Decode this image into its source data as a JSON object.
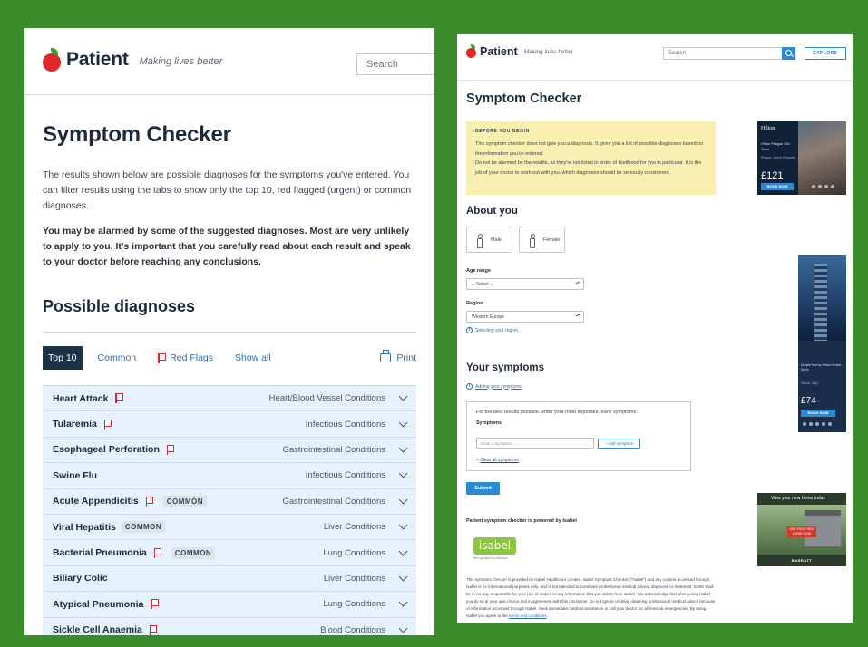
{
  "left": {
    "brand": "Patient",
    "tagline": "Making lives better",
    "search_placeholder": "Search",
    "title": "Symptom Checker",
    "intro": "The results shown below are possible diagnoses for the symptoms you've entered. You can filter results using the tabs to show only the top 10, red flagged (urgent) or common diagnoses.",
    "warning": "You may be alarmed by some of the suggested diagnoses. Most are very unlikely to apply to you. It's important that you carefully read about each result and speak to your doctor before reaching any conclusions.",
    "section_title": "Possible diagnoses",
    "tabs": [
      "Top 10",
      "Common",
      "Red Flags",
      "Show all"
    ],
    "print_label": "Print",
    "badge_common": "COMMON",
    "diagnoses": [
      {
        "name": "Heart Attack",
        "category": "Heart/Blood Vessel Conditions",
        "red_flag": true,
        "common": false
      },
      {
        "name": "Tularemia",
        "category": "Infectious Conditions",
        "red_flag": true,
        "common": false
      },
      {
        "name": "Esophageal Perforation",
        "category": "Gastrointestinal Conditions",
        "red_flag": true,
        "common": false
      },
      {
        "name": "Swine Flu",
        "category": "Infectious Conditions",
        "red_flag": false,
        "common": false
      },
      {
        "name": "Acute Appendicitis",
        "category": "Gastrointestinal Conditions",
        "red_flag": true,
        "common": true
      },
      {
        "name": "Viral Hepatitis",
        "category": "Liver Conditions",
        "red_flag": false,
        "common": true
      },
      {
        "name": "Bacterial Pneumonia",
        "category": "Lung Conditions",
        "red_flag": true,
        "common": true
      },
      {
        "name": "Biliary Colic",
        "category": "Liver Conditions",
        "red_flag": false,
        "common": false
      },
      {
        "name": "Atypical Pneumonia",
        "category": "Lung Conditions",
        "red_flag": true,
        "common": false
      },
      {
        "name": "Sickle Cell Anaemia",
        "category": "Blood Conditions",
        "red_flag": true,
        "common": false
      }
    ]
  },
  "right": {
    "brand": "Patient",
    "tagline": "Making lives better",
    "search_placeholder": "Search",
    "explore_label": "EXPLORE",
    "title": "Symptom Checker",
    "notice_title": "BEFORE YOU BEGIN",
    "notice_p1": "This symptom checker does not give you a diagnosis. It gives you a list of possible diagnoses based on the information you've entered.",
    "notice_p2": "Do not be alarmed by the results, as they're not listed in order of likelihood for you in particular. It is the job of your doctor to work out with you, which diagnoses should be seriously considered.",
    "about_title": "About you",
    "male_label": "Male",
    "female_label": "Female",
    "age_label": "Age range",
    "age_value": "-- Select --",
    "region_label": "Region",
    "region_value": "Western Europe",
    "region_help": "Selecting your region",
    "symptoms_title": "Your symptoms",
    "symptoms_help": "Adding your symptoms",
    "symptoms_intro": "For the best results possible, enter your most important, early symptoms.",
    "symptoms_label": "Symptoms",
    "symptom_placeholder": "Enter a symptom...",
    "add_symptom_label": "+ Add symptom",
    "clear_label": "Clear all symptoms",
    "submit_label": "Submit",
    "powered_by": "Patient symptom checker is powered by Isabel",
    "isabel_word": "isabel",
    "isabel_tag": "the symptom checker",
    "disclaimer": "This symptom checker is provided by Isabel Healthcare Limited. Isabel Symptom Checker (\"Isabel\") and any content accessed through Isabel is for informational purposes only, and is not intended to constitute professional medical advice, diagnosis or treatment. EMIS shall be in no way responsible for your use of Isabel, or any information that you obtain from Isabel. You acknowledge that when using Isabel you do so at your own choice and in agreement with this disclaimer. Do not ignore or delay obtaining professional medical advice because of information accessed through Isabel. Seek immediate medical assistance or call your doctor for all medical emergencies. By using Isabel you agree to the",
    "disclaimer_link": "terms and conditions",
    "ad1": {
      "brand": "Hilton",
      "hotel": "Hilton Prague Old Town",
      "location": "Prague, Czech Republic",
      "from": "From",
      "price": "£121",
      "book": "BOOK NOW"
    },
    "ad2": {
      "hotel": "DoubleTree by Hilton Venice - North",
      "location": "Venice, Italy",
      "price": "£74",
      "book": "BOOK NOW"
    },
    "ad3": {
      "header": "View your new home today",
      "cta": "SEE YOUR NEW HOME NOW",
      "brand": "BARRATT"
    }
  }
}
